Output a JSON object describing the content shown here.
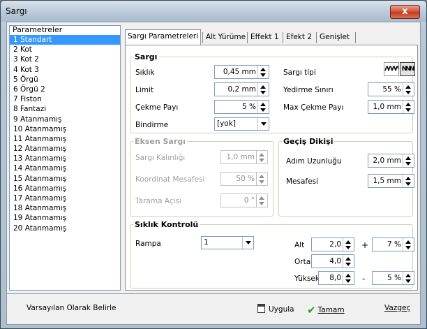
{
  "window": {
    "title": "Sargı",
    "close_label": "x"
  },
  "params": {
    "header": "Parametreler",
    "items": [
      "1  Standart",
      "2  Kot",
      "3  Kot 2",
      "4  Kot 3",
      "5  Örgü",
      "6  Örgü 2",
      "7  Fiston",
      "8  Fantazi",
      "9  Atanmamış",
      "10 Atanmamış",
      "11 Atanmamış",
      "12 Atanmamış",
      "13 Atanmamış",
      "14 Atanmamış",
      "15 Atanmamış",
      "16 Atanmamış",
      "17 Atanmamış",
      "18 Atanmamış",
      "19 Atanmamış",
      "20 Atanmamış"
    ],
    "selected_index": 0
  },
  "tabs": [
    "Sargı Parametreleri",
    "Alt Yürüme",
    "Effekt 1",
    "Efekt 2",
    "Genişlet"
  ],
  "sargi": {
    "legend": "Sargı",
    "siklik_label": "Sıklık",
    "siklik_value": "0,45 mm",
    "limit_label": "Limit",
    "limit_value": "0,2 mm",
    "cekme_label": "Çekme Payı",
    "cekme_value": "5 %",
    "bindirme_label": "Bindirme",
    "bindirme_value": "[yok]",
    "tipi_label": "Sargı tipi",
    "yedirme_label": "Yedirme Sınırı",
    "yedirme_value": "55 %",
    "maxcekme_label": "Max Çekme Payı",
    "maxcekme_value": "1,0 mm"
  },
  "eksen": {
    "legend": "Eksen Sargı",
    "kalinlik_label": "Sargı Kalınlığı",
    "kalinlik_value": "1,0 mm",
    "koordinat_label": "Koordinat Mesafesi",
    "koordinat_value": "50 %",
    "tarama_label": "Tarama Açısı",
    "tarama_value": "0 °"
  },
  "gecis": {
    "legend": "Geçiş Dikişi",
    "adim_label": "Adım Uzunluğu",
    "adim_value": "2,0 mm",
    "mesafe_label": "Mesafesi",
    "mesafe_value": "1,5 mm"
  },
  "siklik_kontrolu": {
    "legend": "Sıklık Kontrolü",
    "rampa_label": "Rampa",
    "rampa_value": "1",
    "alt_label": "Alt",
    "alt_value": "2,0",
    "plus": "+",
    "plus_value": "7 %",
    "orta_label": "Orta",
    "orta_value": "4,0",
    "yuksek_label": "Yüksek",
    "yuksek_value": "8,0",
    "minus": "-",
    "minus_value": "5 %"
  },
  "footer": {
    "default_label": "Varsayılan Olarak Belirle",
    "apply_label": "Uygula",
    "ok_label": "Tamam",
    "cancel_label": "Vazgeç"
  }
}
